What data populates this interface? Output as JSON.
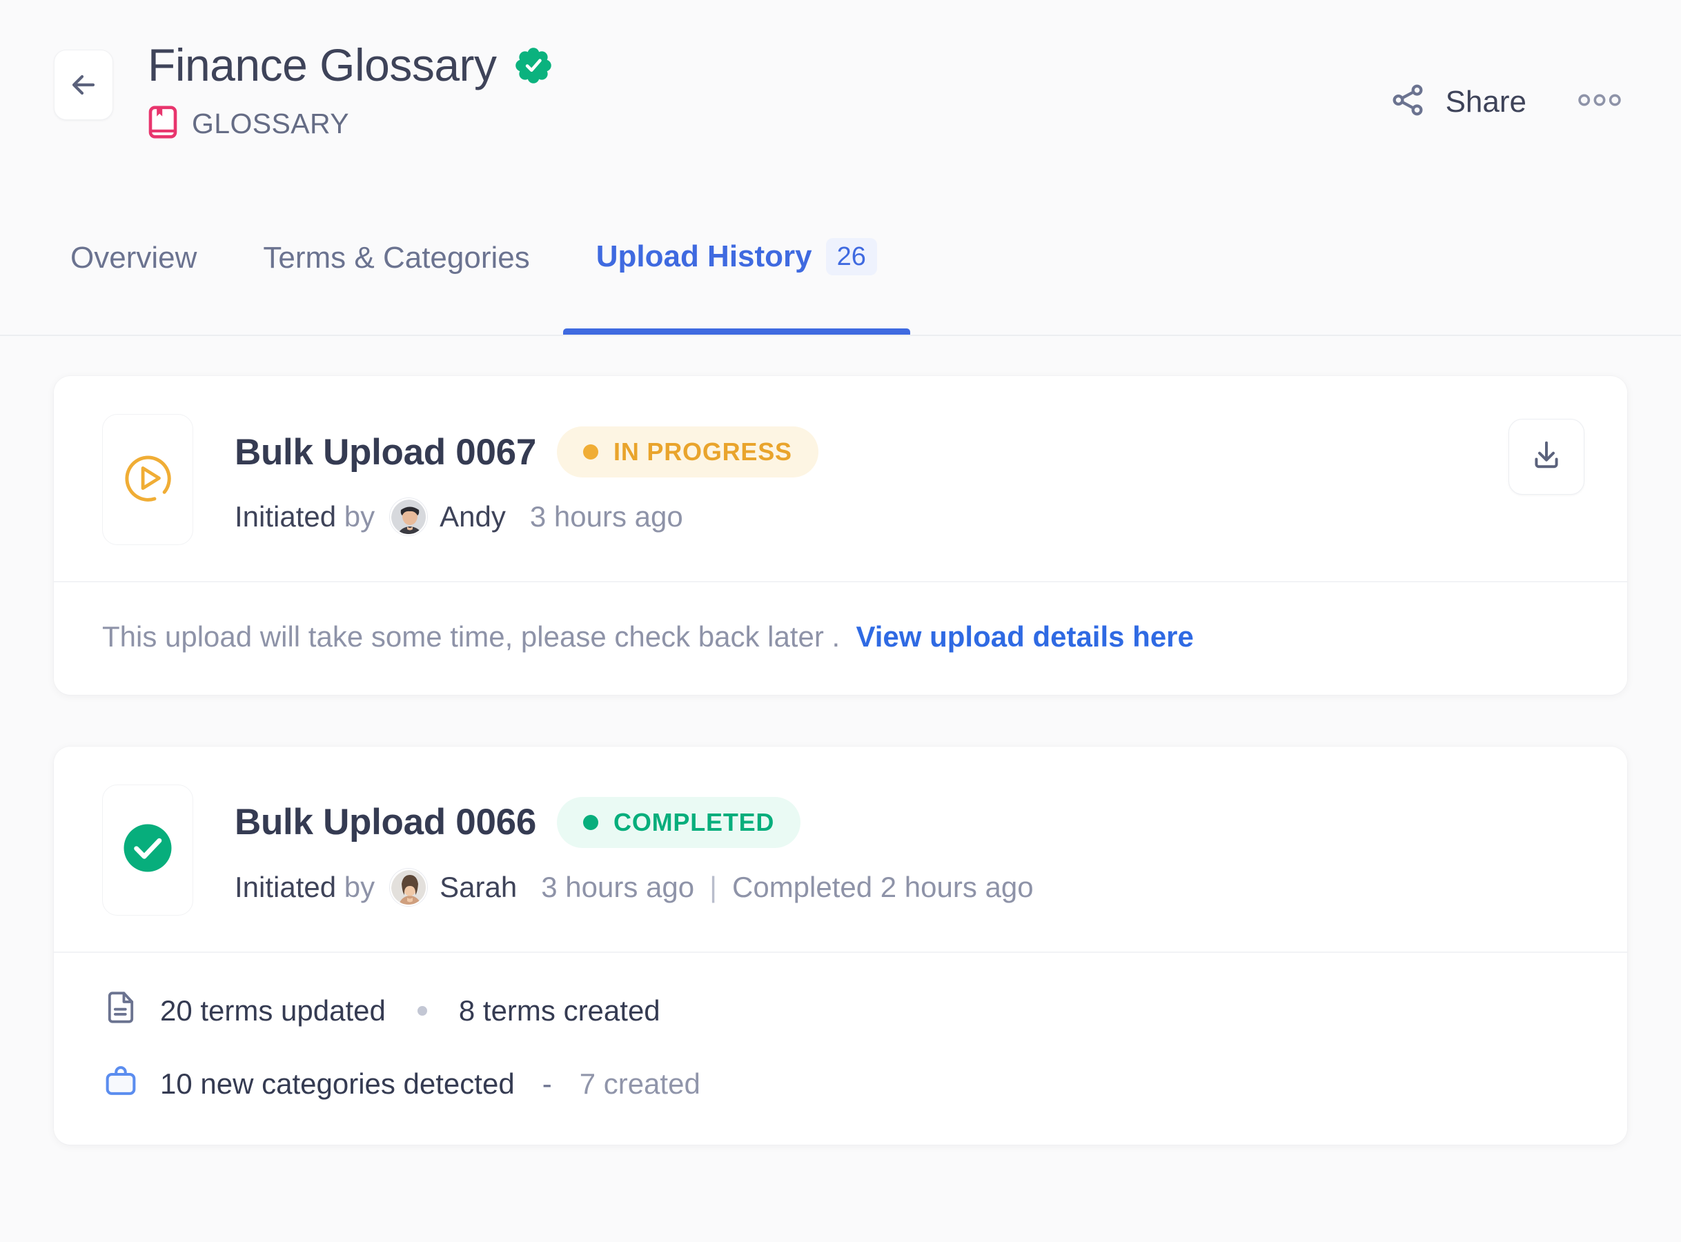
{
  "header": {
    "back_icon": "arrow-left-icon",
    "title": "Finance Glossary",
    "verified_icon": "verified-badge-icon",
    "asset_type_icon": "book-icon",
    "asset_type": "GLOSSARY",
    "share_icon": "share-nodes-icon",
    "share_label": "Share",
    "more_icon": "more-horizontal-icon"
  },
  "tabs": [
    {
      "label": "Overview",
      "active": false,
      "badge": ""
    },
    {
      "label": "Terms & Categories",
      "active": false,
      "badge": ""
    },
    {
      "label": "Upload History",
      "active": true,
      "badge": "26"
    }
  ],
  "uploads": [
    {
      "status_icon": "play-progress-icon",
      "title": "Bulk Upload 0067",
      "status_label": "IN PROGRESS",
      "status_kind": "progress",
      "initiated_prefix": "Initiated",
      "initiated_by_word": "by",
      "user": "Andy",
      "avatar": "avatar-andy",
      "started": "3 hours ago",
      "download_icon": "download-icon",
      "note": "This upload will take some time, please check back later .",
      "note_link": "View upload details here"
    },
    {
      "status_icon": "check-circle-icon",
      "title": "Bulk Upload 0066",
      "status_label": "COMPLETED",
      "status_kind": "completed",
      "initiated_prefix": "Initiated",
      "initiated_by_word": "by",
      "user": "Sarah",
      "avatar": "avatar-sarah",
      "started": "3 hours ago",
      "separator": "|",
      "completed": "Completed 2 hours ago",
      "stats": [
        {
          "icon": "document-icon",
          "primary": "20 terms updated",
          "secondary": "8 terms created"
        },
        {
          "icon": "briefcase-icon",
          "primary": "10 new categories detected",
          "dash": "-",
          "secondary": "7 created"
        }
      ]
    }
  ],
  "colors": {
    "accent_blue": "#3f6ae0",
    "link_blue": "#2f6ae3",
    "progress_amber": "#e9a42c",
    "completed_green": "#07ae7c",
    "verified_green": "#0bb27e",
    "glossary_pink": "#e8356d",
    "text_dark": "#353b52",
    "text_muted": "#8e93a8",
    "page_bg": "#fafafb"
  }
}
